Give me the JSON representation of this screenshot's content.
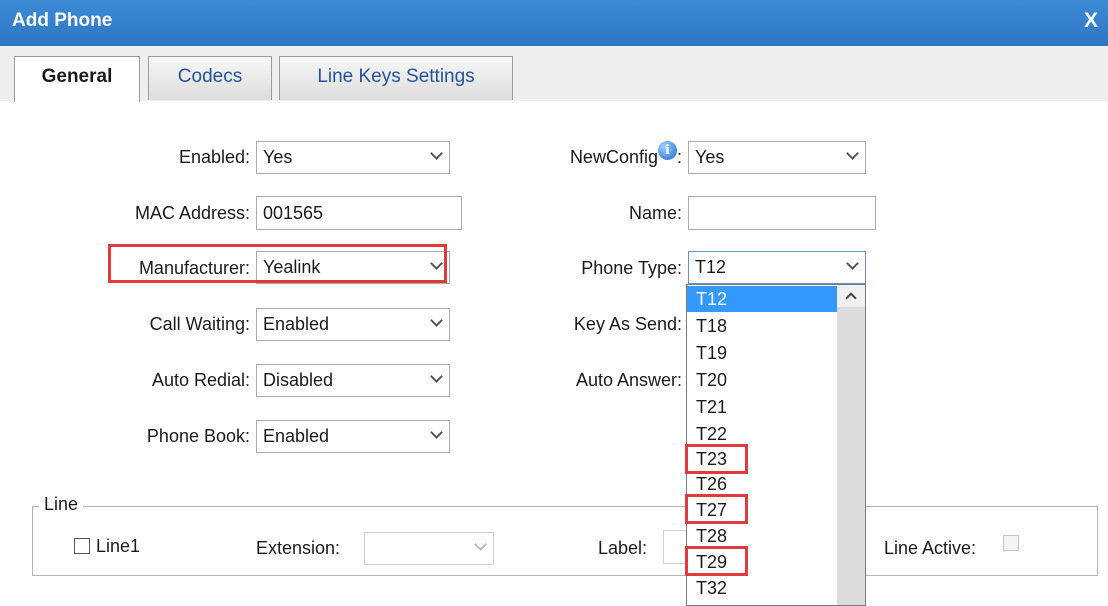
{
  "dialog": {
    "title": "Add Phone",
    "close": "X"
  },
  "tabs": [
    "General",
    "Codecs",
    "Line Keys Settings"
  ],
  "form": {
    "enabled": {
      "label": "Enabled:",
      "value": "Yes"
    },
    "mac": {
      "label": "MAC Address:",
      "value": "001565"
    },
    "manufacturer": {
      "label": "Manufacturer:",
      "value": "Yealink"
    },
    "call_waiting": {
      "label": "Call Waiting:",
      "value": "Enabled"
    },
    "auto_redial": {
      "label": "Auto Redial:",
      "value": "Disabled"
    },
    "phone_book": {
      "label": "Phone Book:",
      "value": "Enabled"
    },
    "new_config": {
      "label": "NewConfig",
      "suffix": ":",
      "value": "Yes",
      "icon": "info-icon"
    },
    "name": {
      "label": "Name:",
      "value": ""
    },
    "phone_type": {
      "label": "Phone Type:",
      "value": "T12"
    },
    "key_as_send": {
      "label": "Key As Send:"
    },
    "auto_answer": {
      "label": "Auto Answer:"
    }
  },
  "phone_type_options": [
    "T12",
    "T18",
    "T19",
    "T20",
    "T21",
    "T22",
    "T23",
    "T26",
    "T27",
    "T28",
    "T29",
    "T32"
  ],
  "highlighted_options": [
    "T23",
    "T27",
    "T29"
  ],
  "line": {
    "legend": "Line",
    "line1": "Line1",
    "extension_label": "Extension:",
    "label_label": "Label:",
    "line_active_label": "Line Active:"
  },
  "colors": {
    "titlebar": "#2d76c2",
    "highlight": "#e03a3e",
    "selected_option": "#3399ff"
  }
}
